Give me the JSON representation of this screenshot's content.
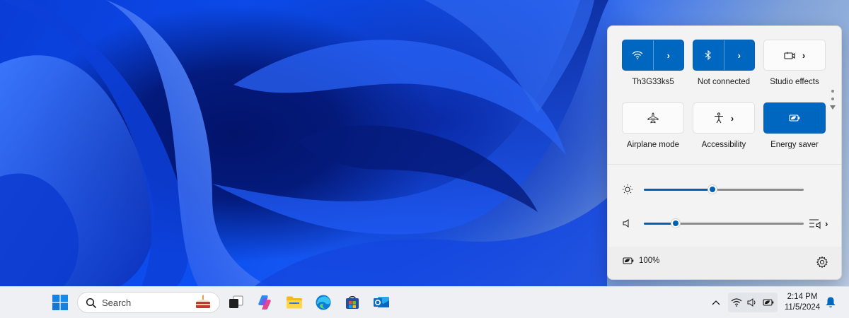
{
  "quick_settings": {
    "tiles": [
      {
        "label": "Th3G33ks5",
        "icon": "wifi-icon",
        "state": "on",
        "expandable": true
      },
      {
        "label": "Not connected",
        "icon": "bluetooth-icon",
        "state": "on",
        "expandable": true
      },
      {
        "label": "Studio effects",
        "icon": "studio-effects-icon",
        "state": "off",
        "expandable": true
      },
      {
        "label": "Airplane mode",
        "icon": "airplane-icon",
        "state": "off",
        "expandable": false
      },
      {
        "label": "Accessibility",
        "icon": "accessibility-icon",
        "state": "off",
        "expandable": true
      },
      {
        "label": "Energy saver",
        "icon": "energy-saver-icon",
        "state": "on",
        "expandable": false
      }
    ],
    "brightness": {
      "icon": "brightness-icon",
      "value_fraction": 0.43
    },
    "volume": {
      "icon": "volume-icon",
      "value_fraction": 0.2
    },
    "battery_label": "100%",
    "accent_color": "#0067c0"
  },
  "taskbar": {
    "search_placeholder": "Search",
    "apps": [
      "windows-start-icon",
      "task-view-icon",
      "copilot-icon",
      "file-explorer-icon",
      "edge-icon",
      "store-icon",
      "outlook-icon"
    ],
    "tray_icons": [
      "chevron-up-icon",
      "wifi-icon",
      "volume-icon",
      "battery-icon"
    ],
    "clock_time": "2:14 PM",
    "clock_date": "11/5/2024"
  }
}
